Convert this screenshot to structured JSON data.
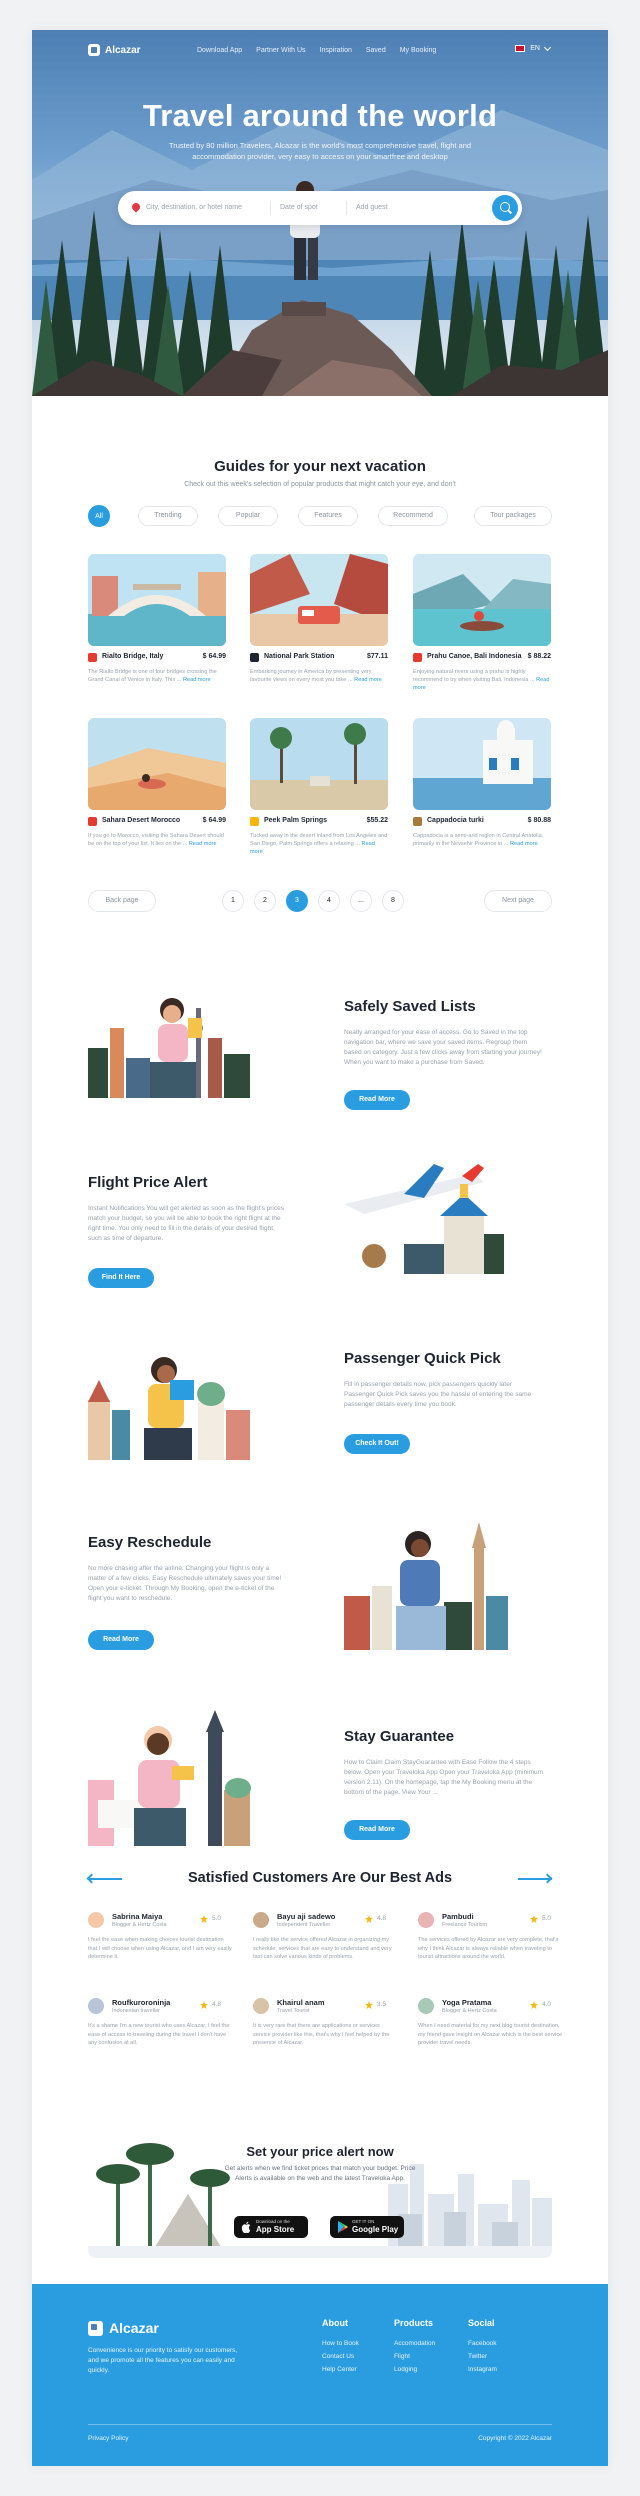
{
  "nav": {
    "brand": "Alcazar",
    "links": [
      "Download App",
      "Partner With Us",
      "Inspiration",
      "Saved",
      "My Booking"
    ],
    "language": "EN"
  },
  "hero": {
    "title": "Travel around the world",
    "subtitle": "Trusted by 80 million Travelers, Alcazar is the world's most comprehensive travel, flight and accommodation provider, very easy to access on your smartfree and desktop",
    "search": {
      "destination_placeholder": "City, destination, or hotel name",
      "date_placeholder": "Date of spot",
      "guests_placeholder": "Add guest"
    }
  },
  "guides": {
    "title": "Guides for your next vacation",
    "subtitle": "Check out this week's selection of popular products that might catch your eye, and don't",
    "filters": [
      "All",
      "Trending",
      "Popular",
      "Features",
      "Recommend",
      "Tour packages"
    ],
    "cards": [
      {
        "name": "Rialto Bridge, Italy",
        "price": "$ 64.99",
        "desc": "The Rialto Bridge is one of four bridges crossing the Grand Canal of Venice in Italy. This ...",
        "more": "Read more"
      },
      {
        "name": "National Park Station",
        "price": "$77.11",
        "desc": "Embarking journey in America by presenting very favourite views on every most you take ...",
        "more": "Read more"
      },
      {
        "name": "Prahu Canoe, Bali Indonesia",
        "price": "$ 88.22",
        "desc": "Enjoying natural rivers using a prahu is highly recommend to try when visiting Bali, Indonesia ...",
        "more": "Read more"
      },
      {
        "name": "Sahara Desert Morocco",
        "price": "$ 64.99",
        "desc": "If you go to Morocco, visiting the Sahara Desert should be on the top of your list. It lies on the ...",
        "more": "Read more"
      },
      {
        "name": "Peek Palm Springs",
        "price": "$55.22",
        "desc": "Tucked away in the desert inland from Los Angeles and San Diego, Palm Springs offers a relaxing ...",
        "more": "Read more"
      },
      {
        "name": "Cappadocia turki",
        "price": "$ 80.88",
        "desc": "Cappadocia is a semi-arid region in Central Anatolia, primarily in the Nevsehir Province in ...",
        "more": "Read more"
      }
    ],
    "pager": {
      "back": "Back page",
      "pages": [
        "1",
        "2",
        "3",
        "4",
        "...",
        "8"
      ],
      "next": "Next page"
    }
  },
  "features": [
    {
      "title": "Safely Saved Lists",
      "text": "Neatly arranged for your ease of access. Go to Saved in the top navigation bar, where we save your saved items. Regroup them based on category. Just a few clicks away from starting your journey! When you want to make a purchase from Saved.",
      "button": "Read More"
    },
    {
      "title": "Flight Price Alert",
      "text": "Instant Notifications You will get alerted as soon as the flight's prices match your budget, so you will be able to book the right flight at the right time. You only need to fill in the details of your desired flight, such as time of departure.",
      "button": "Find It Here"
    },
    {
      "title": "Passenger Quick Pick",
      "text": "Fill in passenger details now, pick passengers quickly later Passenger Quick Pick saves you the hassle of entering the same passenger details every time you book.",
      "button": "Check It Out!"
    },
    {
      "title": "Easy Reschedule",
      "text": "No more chasing after the airline. Changing your flight is only a matter of a few clicks. Easy Reschedule ultimately saves your time! Open your e-ticket. Through My Booking, open the e-ticket of the flight you want to reschedule.",
      "button": "Read More"
    },
    {
      "title": "Stay Guarantee",
      "text": "How to Claim Claim StayGuarantee with Ease Follow the 4 steps below. Open your Traveloka App Open your Traveloka App (minimum version 2.11). On the homepage, tap the My Booking menu at the bottom of the page. View Your ...",
      "button": "Read More"
    }
  ],
  "testimonials": {
    "title": "Satisfied Customers Are Our Best Ads",
    "reviews": [
      {
        "name": "Sabrina Maiya",
        "role": "Blogger & Hertz Costa",
        "rating": "5.0",
        "text": "I feel the ease when making choices tourist destination that I will choose when using Alcazar, and I am very easily determine it.",
        "color": "#f4c9a8"
      },
      {
        "name": "Bayu aji sadewo",
        "role": "Independent Traveller",
        "rating": "4.8",
        "text": "I really like the service offered Alcazar in organizing my schedule, services that are easy to understand and very fast can solve various kinds of problems.",
        "color": "#c9a98a"
      },
      {
        "name": "Pambudi",
        "role": "Freelance Tourism",
        "rating": "5.0",
        "text": "The services offered by Alcazar are very complete, that's why I think Alcazar is always reliable when traveling to tourist attractions around the world.",
        "color": "#e8b4b4"
      },
      {
        "name": "Roufkuroroninja",
        "role": "Indonesian traveller",
        "rating": "4.8",
        "text": "It's a shame I'm a new tourist who uses Alcazar. I feel the ease of access to traveling during the travel I don't have any confusion at all.",
        "color": "#b8c4d8"
      },
      {
        "name": "Khairul anam",
        "role": "Travel Tourist",
        "rating": "3.5",
        "text": "It is very rare that there are applications or services service provider like this, that's why I feel helped by the presence of Alcazar.",
        "color": "#d8c2a8"
      },
      {
        "name": "Yoga Pratama",
        "role": "Blogger & Hertz Costa",
        "rating": "4.0",
        "text": "When I need material for my next blog tourist destination, my friend gave insight on Alcazar which is the best service provider travel needs.",
        "color": "#a8c8b8"
      }
    ]
  },
  "price_alert": {
    "title": "Set your price alert now",
    "text": "Get alerts when we find ticket prices that match your budget. Price Alerts is available on the web and the latest Traveloka App.",
    "app_store_small": "Download on the",
    "app_store": "App Store",
    "play_store_small": "GET IT ON",
    "play_store": "Google Play"
  },
  "footer": {
    "brand": "Alcazar",
    "desc": "Convenience is our priority to satisfy our customers, and we promote all the features you can easily and quickly.",
    "columns": [
      {
        "title": "About",
        "links": [
          "How to Book",
          "Contact Us",
          "Help Center"
        ]
      },
      {
        "title": "Products",
        "links": [
          "Accomodation",
          "Flight",
          "Lodging"
        ]
      },
      {
        "title": "Social",
        "links": [
          "Facebook",
          "Twitter",
          "Instagram"
        ]
      }
    ],
    "policy": "Privacy Policy",
    "copyright": "Copyright © 2022 Alcazar"
  },
  "colors": {
    "accent": "#2a9de0",
    "footer": "#2a9de0",
    "star": "#f5b70a"
  }
}
